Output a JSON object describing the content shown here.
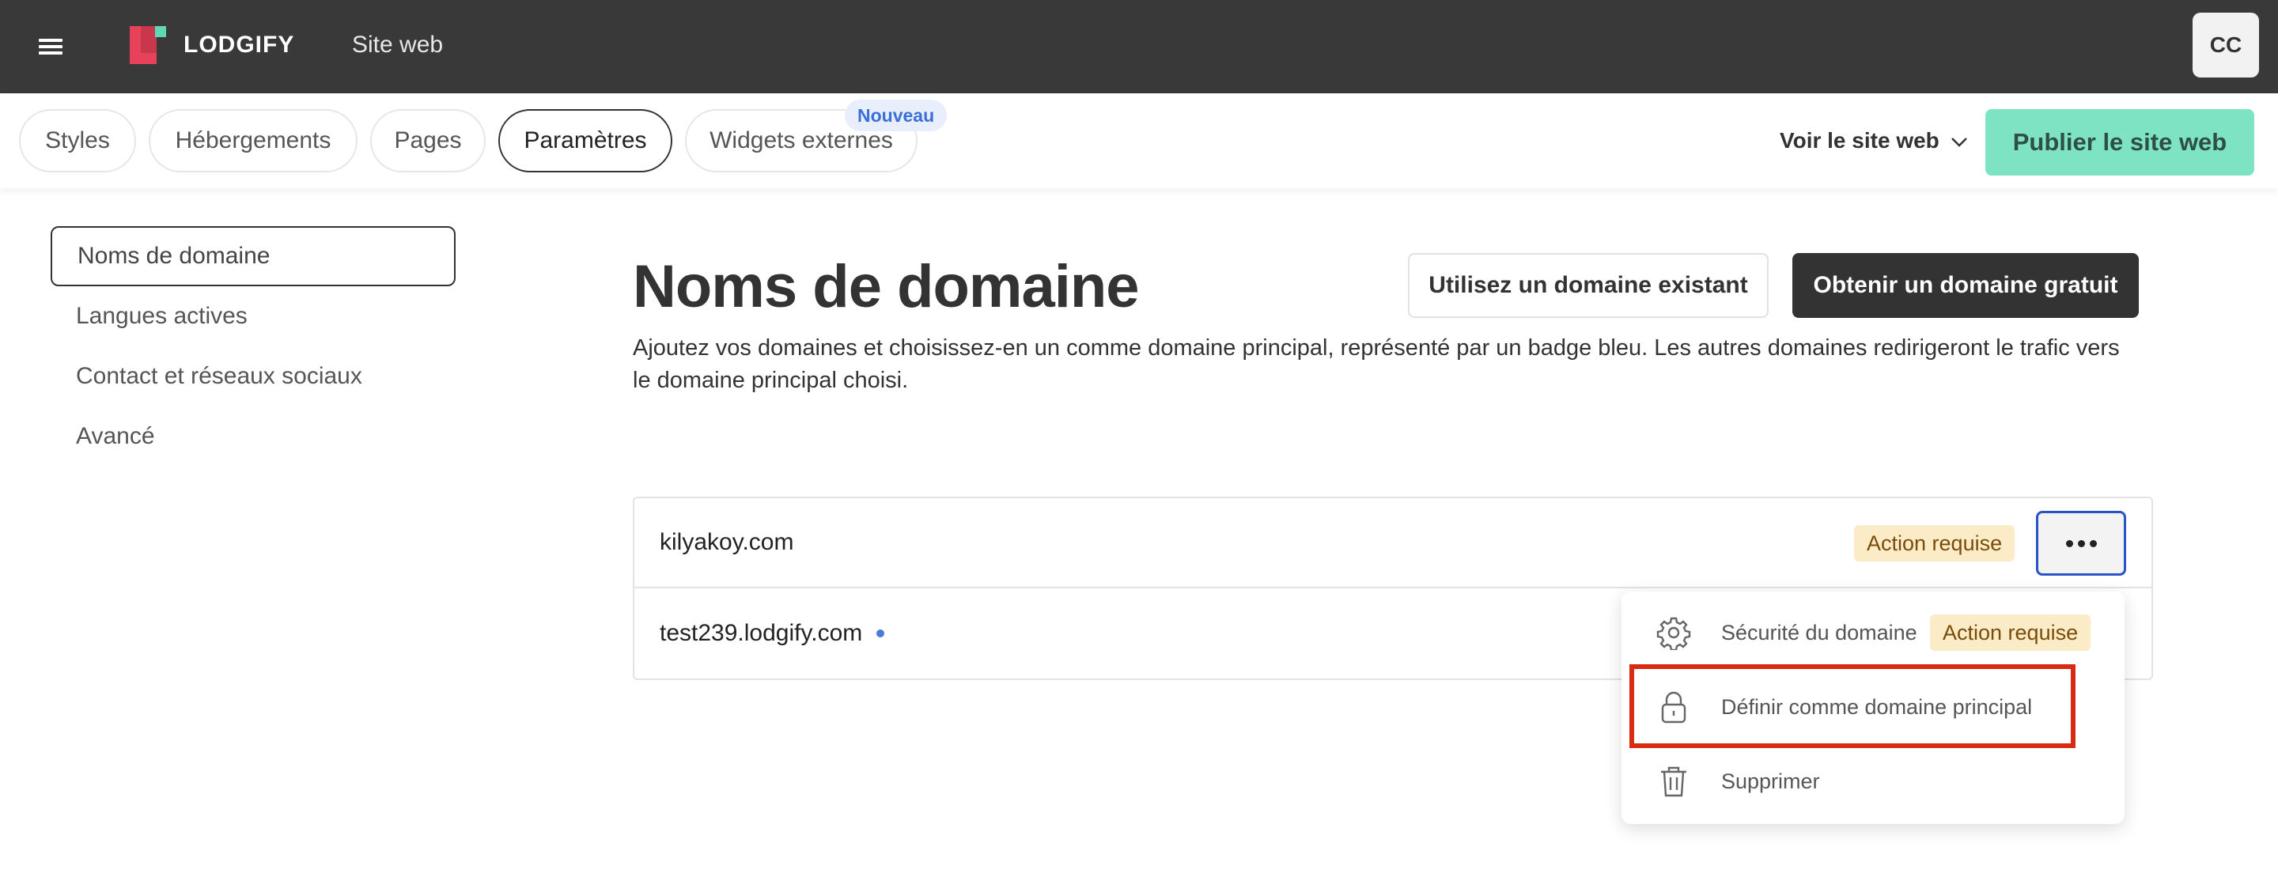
{
  "header": {
    "brand": "LODGIFY",
    "section_title": "Site web",
    "avatar_initials": "CC",
    "bar_color": "#393939"
  },
  "tabs": [
    {
      "label": "Styles",
      "active": false
    },
    {
      "label": "Hébergements",
      "active": false
    },
    {
      "label": "Pages",
      "active": false
    },
    {
      "label": "Paramètres",
      "active": true
    },
    {
      "label": "Widgets externes",
      "active": false
    }
  ],
  "new_badge": "Nouveau",
  "view_site_label": "Voir le site web",
  "publish_label": "Publier le site web",
  "publish_color": "#7ee3c3",
  "sidebar": {
    "items": [
      {
        "label": "Noms de domaine",
        "active": true
      },
      {
        "label": "Langues actives",
        "active": false
      },
      {
        "label": "Contact et réseaux sociaux",
        "active": false
      },
      {
        "label": "Avancé",
        "active": false
      }
    ]
  },
  "main": {
    "title": "Noms de domaine",
    "use_existing_label": "Utilisez un domaine existant",
    "get_free_label": "Obtenir un domaine gratuit",
    "description": "Ajoutez vos domaines et choisissez-en un comme domaine principal, représenté par un badge bleu. Les autres domaines redirigeront le trafic vers le domaine principal choisi.",
    "domains": [
      {
        "name": "kilyakoy.com",
        "badge": "Action requise",
        "primary": false
      },
      {
        "name": "test239.lodgify.com",
        "badge": "",
        "primary": true
      }
    ]
  },
  "menu": {
    "items": [
      {
        "label": "Sécurité du domaine",
        "icon": "gear-icon",
        "badge": "Action requise"
      },
      {
        "label": "Définir comme domaine principal",
        "icon": "lock-icon",
        "badge": ""
      },
      {
        "label": "Supprimer",
        "icon": "trash-icon",
        "badge": ""
      }
    ],
    "highlight_color": "#d92b12"
  }
}
